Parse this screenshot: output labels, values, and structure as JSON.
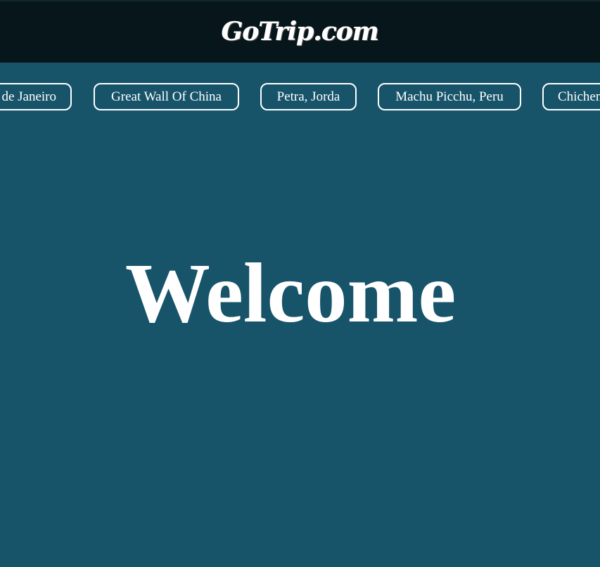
{
  "header": {
    "logo": "GoTrip.com"
  },
  "nav": {
    "items": [
      {
        "label": "de Janeiro"
      },
      {
        "label": "Great Wall Of China"
      },
      {
        "label": "Petra, Jorda"
      },
      {
        "label": "Machu Picchu, Peru"
      },
      {
        "label": "Chichen"
      }
    ]
  },
  "hero": {
    "title": "Welcome"
  },
  "colors": {
    "header_bg": "#07161a",
    "page_bg": "#17546a",
    "text": "#ffffff"
  }
}
